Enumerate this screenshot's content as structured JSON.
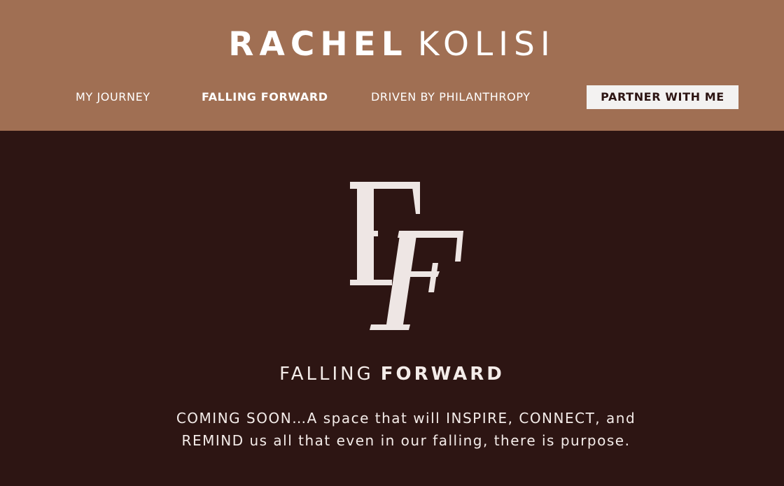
{
  "header": {
    "brand_first": "RACHEL",
    "brand_last": "KOLISI",
    "nav": {
      "journey": "MY JOURNEY",
      "falling": "FALLING FORWARD",
      "driven": "DRIVEN BY PHILANTHROPY",
      "partner": "PARTNER WITH ME"
    },
    "colors": {
      "header_bg": "#a06f53",
      "page_bg": "#2d1513",
      "button_bg": "#f3f2f1"
    }
  },
  "main": {
    "logo_letters": "FF",
    "title_light": "FALLING",
    "title_bold": "FORWARD",
    "body": "COMING SOON…A space that will INSPIRE, CONNECT, and REMIND us all that even in our falling, there is purpose."
  }
}
